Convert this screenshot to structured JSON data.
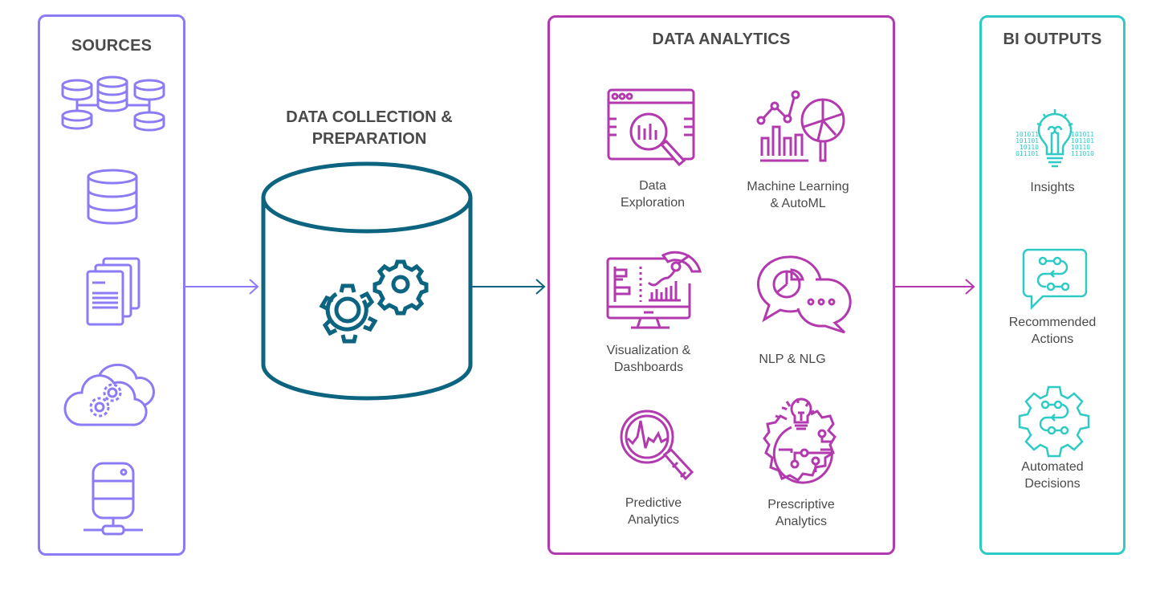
{
  "colors": {
    "sources": "#8b7cf6",
    "collection": "#0d6480",
    "analytics": "#b23aae",
    "outputs": "#2ecac4",
    "text": "#4a4a4a"
  },
  "sources": {
    "title": "SOURCES",
    "items": [
      {
        "icon": "connected-databases-icon"
      },
      {
        "icon": "database-icon"
      },
      {
        "icon": "documents-icon"
      },
      {
        "icon": "cloud-gears-icon"
      },
      {
        "icon": "server-network-icon"
      }
    ]
  },
  "collection": {
    "title_line1": "DATA COLLECTION &",
    "title_line2": "PREPARATION",
    "icon": "database-gears-icon"
  },
  "analytics": {
    "title": "DATA ANALYTICS",
    "items": [
      {
        "label_line1": "Data",
        "label_line2": "Exploration",
        "icon": "browser-magnifier-chart-icon"
      },
      {
        "label_line1": "Machine Learning",
        "label_line2": "& AutoML",
        "icon": "chart-magnifier-pie-icon"
      },
      {
        "label_line1": "Visualization &",
        "label_line2": "Dashboards",
        "icon": "monitor-dashboard-icon"
      },
      {
        "label_line1": "NLP & NLG",
        "label_line2": "",
        "icon": "chat-bubbles-icon"
      },
      {
        "label_line1": "Predictive",
        "label_line2": "Analytics",
        "icon": "magnifier-waveform-icon"
      },
      {
        "label_line1": "Prescriptive",
        "label_line2": "Analytics",
        "icon": "gear-lightbulb-circuit-icon"
      }
    ]
  },
  "outputs": {
    "title": "BI OUTPUTS",
    "items": [
      {
        "label_line1": "Insights",
        "label_line2": "",
        "icon": "lightbulb-binary-icon",
        "binary_left": [
          "101011",
          "101101",
          "10110",
          "011101"
        ],
        "binary_right": [
          "101011",
          "101101",
          "10110",
          "111010"
        ]
      },
      {
        "label_line1": "Recommended",
        "label_line2": "Actions",
        "icon": "chat-flow-icon"
      },
      {
        "label_line1": "Automated",
        "label_line2": "Decisions",
        "icon": "gear-flow-icon"
      }
    ]
  }
}
